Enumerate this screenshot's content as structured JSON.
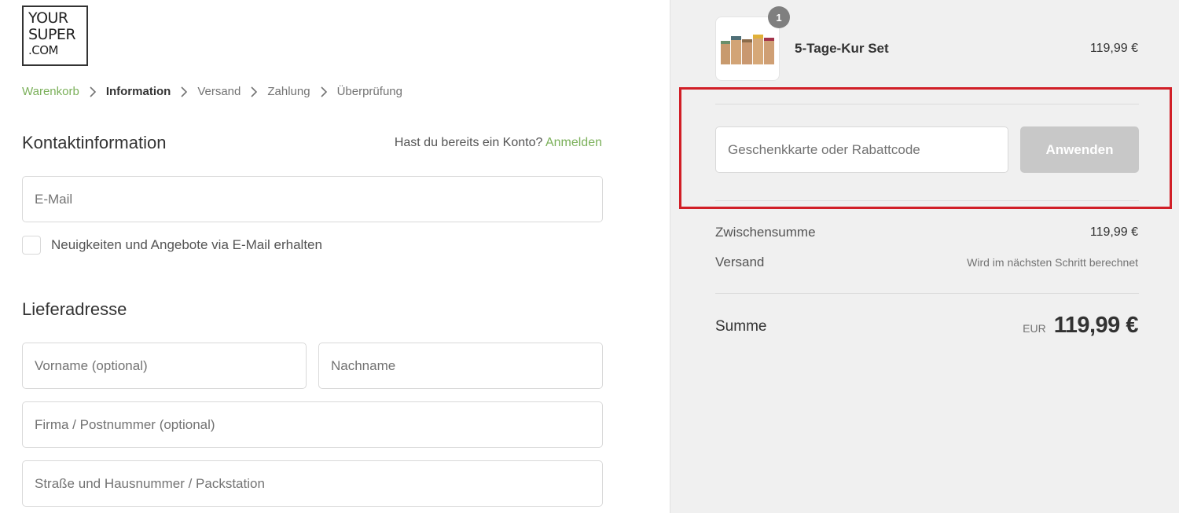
{
  "logo": {
    "line1": "YOUR",
    "line2": "SUPER",
    "line3": ".COM"
  },
  "breadcrumb": {
    "items": [
      {
        "label": "Warenkorb",
        "state": "link"
      },
      {
        "label": "Information",
        "state": "current"
      },
      {
        "label": "Versand",
        "state": "upcoming"
      },
      {
        "label": "Zahlung",
        "state": "upcoming"
      },
      {
        "label": "Überprüfung",
        "state": "upcoming"
      }
    ]
  },
  "contact": {
    "title": "Kontaktinformation",
    "account_prompt": "Hast du bereits ein Konto?",
    "login_link": "Anmelden",
    "email_placeholder": "E-Mail",
    "newsletter_label": "Neuigkeiten und Angebote via E-Mail erhalten"
  },
  "shipping": {
    "title": "Lieferadresse",
    "firstname_placeholder": "Vorname (optional)",
    "lastname_placeholder": "Nachname",
    "company_placeholder": "Firma / Postnummer (optional)",
    "street_placeholder": "Straße und Hausnummer / Packstation"
  },
  "summary": {
    "product": {
      "name": "5-Tage-Kur Set",
      "price": "119,99 €",
      "quantity": "1"
    },
    "discount": {
      "placeholder": "Geschenkkarte oder Rabattcode",
      "button_label": "Anwenden"
    },
    "subtotal_label": "Zwischensumme",
    "subtotal_value": "119,99 €",
    "shipping_label": "Versand",
    "shipping_value": "Wird im nächsten Schritt berechnet",
    "total_label": "Summe",
    "total_currency": "EUR",
    "total_value": "119,99 €"
  },
  "colors": {
    "accent_green": "#7bb05a",
    "highlight_red": "#d11f27",
    "summary_background": "#f0f0f0",
    "button_disabled": "#c8c8c8"
  }
}
